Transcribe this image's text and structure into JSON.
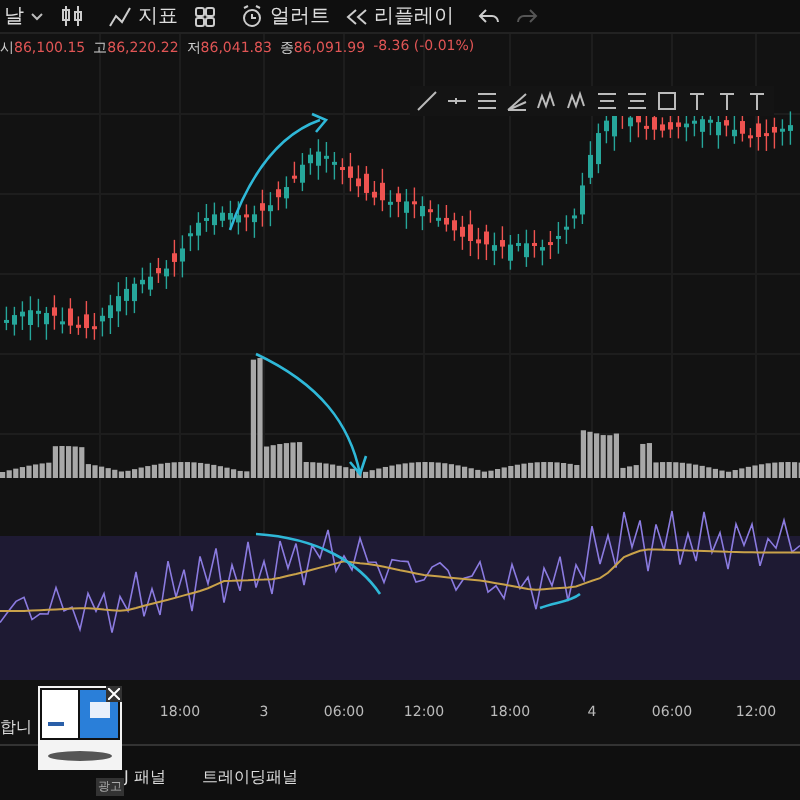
{
  "toolbar": {
    "items": [
      {
        "kind": "interval",
        "label": "날"
      },
      {
        "kind": "chart-type"
      },
      {
        "kind": "indicators",
        "label": "지표"
      },
      {
        "kind": "layout"
      },
      {
        "kind": "alert",
        "label": "얼러트"
      },
      {
        "kind": "replay",
        "label": "리플레이"
      },
      {
        "kind": "undo"
      },
      {
        "kind": "redo",
        "disabled": true
      }
    ]
  },
  "ohlc": [
    {
      "label": "시",
      "value": "86,100.15"
    },
    {
      "label": "고",
      "value": "86,220.22"
    },
    {
      "label": "저",
      "value": "86,041.83"
    },
    {
      "label": "종",
      "value": "86,091.99"
    }
  ],
  "change": "-8.36 (-0.01%)",
  "time_axis": [
    "18:00",
    "3",
    "06:00",
    "12:00",
    "18:00",
    "4",
    "06:00",
    "12:00"
  ],
  "side_text": "합니",
  "ad": {
    "label": "광고"
  },
  "bottom_tabs": [
    {
      "label": "J 패널"
    },
    {
      "label": "트레이딩패널"
    }
  ]
}
